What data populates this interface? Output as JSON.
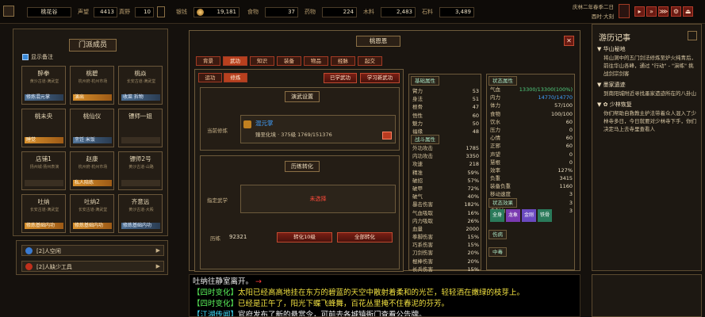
{
  "topbar": {
    "location": "桃花谷",
    "reputation_label": "声望",
    "reputation_value": "4413",
    "energy_label": "真野",
    "energy_value": "10",
    "resources": [
      {
        "label": "银钱",
        "value": "19,181"
      },
      {
        "label": "食物",
        "value": "37"
      },
      {
        "label": "药物",
        "value": "224"
      },
      {
        "label": "木料",
        "value": "2,483"
      },
      {
        "label": "石料",
        "value": "3,489"
      }
    ],
    "date": "庆林二年春季二日",
    "time": "酉时·大刻"
  },
  "members": {
    "title": "门派成员",
    "show_remarks_label": "显示备注",
    "list": [
      {
        "name": "醉拳",
        "sub": "黄沙古道·满武堂",
        "bar": "修炼混元掌",
        "bar_color": "blue"
      },
      {
        "name": "桃碧",
        "sub": "杭州府·杭州市场",
        "bar": "演出",
        "bar_color": "orange"
      },
      {
        "name": "桃焱",
        "sub": "长安古道·满武堂",
        "bar": "收菜 拆物",
        "bar_color": "blue"
      },
      {
        "name": "桃未央",
        "sub": "",
        "bar": "睡觉",
        "bar_color": "orange"
      },
      {
        "name": "桃仙仪",
        "sub": "",
        "bar": "烹饪 米饭",
        "bar_color": "blue"
      },
      {
        "name": "镖师一姐",
        "sub": "",
        "bar": "",
        "bar_color": "none"
      },
      {
        "name": "店铺1",
        "sub": "扬州城·扬州表演",
        "bar": "",
        "bar_color": "none"
      },
      {
        "name": "赵康",
        "sub": "杭州府·杭州市场",
        "bar": "私人陪练",
        "bar_color": "orange"
      },
      {
        "name": "镖师2号",
        "sub": "黄沙古道·山路",
        "bar": "",
        "bar_color": "none"
      },
      {
        "name": "吐纳",
        "sub": "长安古道·满武堂",
        "bar": "修炼基础内功",
        "bar_color": "orange"
      },
      {
        "name": "吐纳2",
        "sub": "长安古道·满武堂",
        "bar": "修炼基础内功",
        "bar_color": "orange"
      },
      {
        "name": "齐意远",
        "sub": "黄沙古道·大殿",
        "bar": "修炼基础内功",
        "bar_color": "blue"
      }
    ]
  },
  "quests": [
    {
      "label": "[2]人空闲"
    },
    {
      "label": "[2]人缺少工具"
    }
  ],
  "character": {
    "name": "桃恩恩",
    "tabs": [
      "背景",
      "武功",
      "知识",
      "装备",
      "物品",
      "经脉",
      "起交"
    ],
    "active_tab": 1,
    "subtabs": [
      "运功",
      "修炼"
    ],
    "active_subtab": 1,
    "learned_btn": "已学武功",
    "learn_new_btn": "学习新武功",
    "practice_setting_title": "演武设置",
    "current_practice_label": "当前修炼",
    "skill_name": "混元掌",
    "skill_progress": "臻至化境 · 375级    1769/151376",
    "training_title": "历练转化",
    "target_label": "指定武学",
    "not_selected": "未选择",
    "exp_label": "历练",
    "exp_value": "92321",
    "convert10_btn": "转化10级",
    "convert_all_btn": "全部转化"
  },
  "stats": {
    "base_title": "基础属性",
    "base": [
      {
        "k": "臂力",
        "v": "53"
      },
      {
        "k": "身法",
        "v": "51"
      },
      {
        "k": "根骨",
        "v": "47"
      },
      {
        "k": "悟性",
        "v": "60"
      },
      {
        "k": "魅力",
        "v": "50"
      },
      {
        "k": "福缘",
        "v": "48"
      }
    ],
    "battle_title": "战斗属性",
    "battle": [
      {
        "k": "外功攻击",
        "v": "1785"
      },
      {
        "k": "内功攻击",
        "v": "3350"
      },
      {
        "k": "攻速",
        "v": "218"
      },
      {
        "k": "精准",
        "v": "59%"
      },
      {
        "k": "破招",
        "v": "57%"
      },
      {
        "k": "破甲",
        "v": "72%"
      },
      {
        "k": "破气",
        "v": "40%"
      },
      {
        "k": "暴击伤害",
        "v": "182%"
      },
      {
        "k": "气血吸取",
        "v": "16%"
      },
      {
        "k": "内力吸取",
        "v": "26%"
      },
      {
        "k": "血量",
        "v": "2000"
      },
      {
        "k": "拳脚伤害",
        "v": "15%"
      },
      {
        "k": "巧系伤害",
        "v": "15%"
      },
      {
        "k": "刀剑伤害",
        "v": "20%"
      },
      {
        "k": "棍棒伤害",
        "v": "20%"
      },
      {
        "k": "长兵伤害",
        "v": "15%"
      }
    ],
    "state_title": "状态属性",
    "state": [
      {
        "k": "气血",
        "v": "13300/13300(100%)"
      },
      {
        "k": "内力",
        "v": "14770/14770"
      },
      {
        "k": "体力",
        "v": "57/100"
      },
      {
        "k": "食物",
        "v": "100/100"
      },
      {
        "k": "饮水",
        "v": "60"
      },
      {
        "k": "压力",
        "v": "0"
      },
      {
        "k": "心情",
        "v": "60"
      },
      {
        "k": "正邪",
        "v": "60"
      },
      {
        "k": "声望",
        "v": "0"
      },
      {
        "k": "慧根",
        "v": "0"
      },
      {
        "k": "效率",
        "v": "127%"
      },
      {
        "k": "负重",
        "v": "3415"
      },
      {
        "k": "装备负重",
        "v": "1160"
      },
      {
        "k": "移动速度",
        "v": "3"
      },
      {
        "k": "移动消耗",
        "v": "3"
      },
      {
        "k": "牵制力",
        "v": "3"
      }
    ],
    "effect_title": "状态效果",
    "effects": [
      "全身",
      "龙象",
      "金刚",
      "铁骨"
    ],
    "injury_title": "伤病",
    "poison_title": "中毒"
  },
  "chronicle": {
    "title": "游历记事",
    "entries": [
      {
        "head": "▼ 华山秘地",
        "text": "将山洞中的五门剑法修炼至炉火纯青后，前往华山各峰，通过 \"行动\" - \"演练\" 挑战剑宗剑客"
      },
      {
        "head": "▼ 墨家遗迹",
        "text": "到南阳城附近寻找墨家遗迹所在的八卦山"
      },
      {
        "head": "▼ ✿ 少林恢复",
        "text": "你们帮助自救教主护法带着众人混入了少林寺多日，今日就要对少林寺下手，你们决定马上去寺里查看人"
      }
    ]
  },
  "log": {
    "lines": [
      [
        {
          "t": "吐纳往静室离开。",
          "c": "w"
        },
        {
          "t": " →",
          "c": "r"
        }
      ],
      [
        {
          "t": "【四时变化】",
          "c": "g"
        },
        {
          "t": "太阳已经高高地挂在东方的碧蓝的天空中散射着柔和的光芒，轻轻洒在嫩绿的枝芽上。",
          "c": "y"
        }
      ],
      [
        {
          "t": "【四时变化】",
          "c": "g"
        },
        {
          "t": "已经是正午了，阳光下蝶飞蜂舞，百花丛里掩不住春泥的芬芳。",
          "c": "y"
        }
      ],
      [
        {
          "t": "【江湖传闻】",
          "c": "c"
        },
        {
          "t": "官府发布了新的悬赏令，可前去各城镇衙门查看公告牌。",
          "c": "w"
        }
      ]
    ]
  }
}
